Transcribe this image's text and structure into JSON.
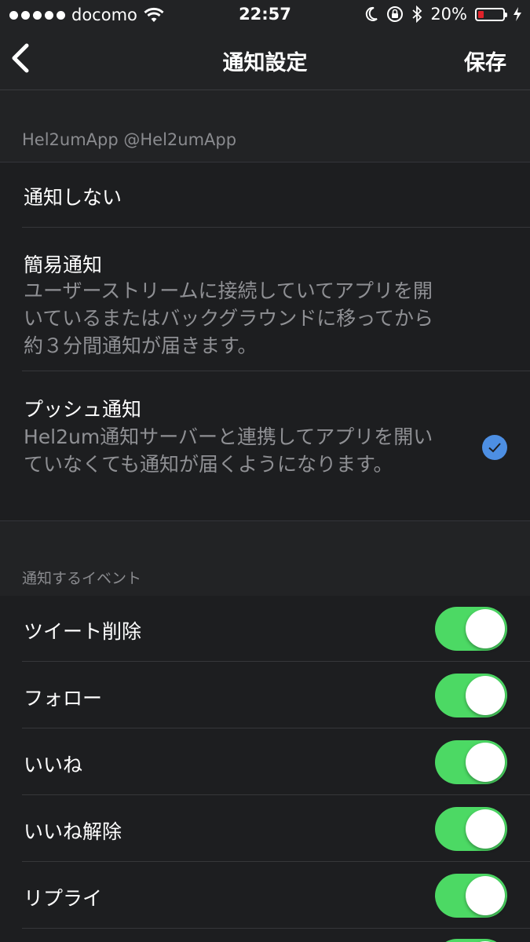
{
  "status_bar": {
    "carrier": "docomo",
    "time": "22:57",
    "battery_percent": "20%",
    "battery_level": 0.2,
    "icons": [
      "signal-dots-icon",
      "wifi-icon",
      "moon-icon",
      "rotation-lock-icon",
      "bluetooth-icon",
      "battery-icon",
      "charging-bolt-icon"
    ]
  },
  "nav": {
    "title": "通知設定",
    "save_label": "保存",
    "back_icon": "chevron-left-icon"
  },
  "account_section": {
    "header": "Hel2umApp @Hel2umApp",
    "options": [
      {
        "title": "通知しない",
        "description": "",
        "selected": false
      },
      {
        "title": "簡易通知",
        "description": "ユーザーストリームに接続していてアプリを開いているまたはバックグラウンドに移ってから約３分間通知が届きます。",
        "selected": false
      },
      {
        "title": "プッシュ通知",
        "description": "Hel2um通知サーバーと連携してアプリを開いていなくても通知が届くようになります。",
        "selected": true
      }
    ]
  },
  "events_section": {
    "header": "通知するイベント",
    "items": [
      {
        "label": "ツイート削除",
        "enabled": true
      },
      {
        "label": "フォロー",
        "enabled": true
      },
      {
        "label": "いいね",
        "enabled": true
      },
      {
        "label": "いいね解除",
        "enabled": true
      },
      {
        "label": "リプライ",
        "enabled": true
      }
    ]
  },
  "colors": {
    "background": "#1d1e20",
    "section_background": "#222325",
    "toggle_on": "#4cd964",
    "check_blue": "#4d8fe3",
    "secondary_text": "#8f9094",
    "battery_low": "#e0222a"
  }
}
